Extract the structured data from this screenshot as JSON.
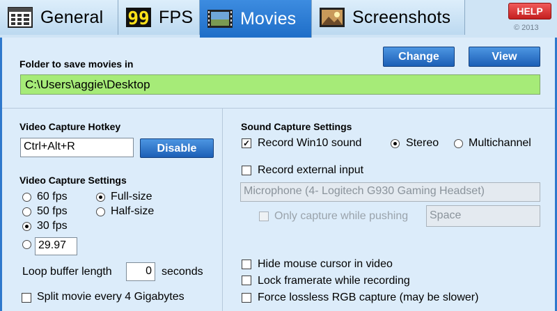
{
  "tabs": {
    "general": "General",
    "fps": "FPS",
    "movies": "Movies",
    "screenshots": "Screenshots"
  },
  "help_label": "HELP",
  "copyright": "© 2013",
  "folder": {
    "label": "Folder to save movies in",
    "path": "C:\\Users\\aggie\\Desktop",
    "change_label": "Change",
    "view_label": "View"
  },
  "hotkey": {
    "label": "Video Capture Hotkey",
    "value": "Ctrl+Alt+R",
    "disable_label": "Disable"
  },
  "video_settings": {
    "label": "Video Capture Settings",
    "fps_options": [
      "60 fps",
      "50 fps",
      "30 fps"
    ],
    "selected_fps": "30 fps",
    "custom_fps": "29.97",
    "size_options": [
      "Full-size",
      "Half-size"
    ],
    "selected_size": "Full-size"
  },
  "loop_buffer": {
    "label": "Loop buffer length",
    "value": "0",
    "unit": "seconds"
  },
  "split_movie": {
    "label": "Split movie every 4 Gigabytes",
    "checked": false
  },
  "sound": {
    "label": "Sound Capture Settings",
    "record_win10": {
      "label": "Record Win10 sound",
      "checked": true
    },
    "channel_options": [
      "Stereo",
      "Multichannel"
    ],
    "selected_channel": "Stereo",
    "record_external": {
      "label": "Record external input",
      "checked": false
    },
    "microphone": "Microphone (4- Logitech G930 Gaming Headset)",
    "push_to_talk": {
      "label": "Only capture while pushing",
      "checked": false,
      "key": "Space"
    }
  },
  "options": {
    "hide_cursor": {
      "label": "Hide mouse cursor in video",
      "checked": false
    },
    "lock_framerate": {
      "label": "Lock framerate while recording",
      "checked": false
    },
    "lossless": {
      "label": "Force lossless RGB capture (may be slower)",
      "checked": false
    }
  },
  "colors": {
    "accent": "#2e78cc",
    "folder_field": "#a6eb78",
    "help_button": "#d83535",
    "panel_bg": "#dcecfa"
  }
}
